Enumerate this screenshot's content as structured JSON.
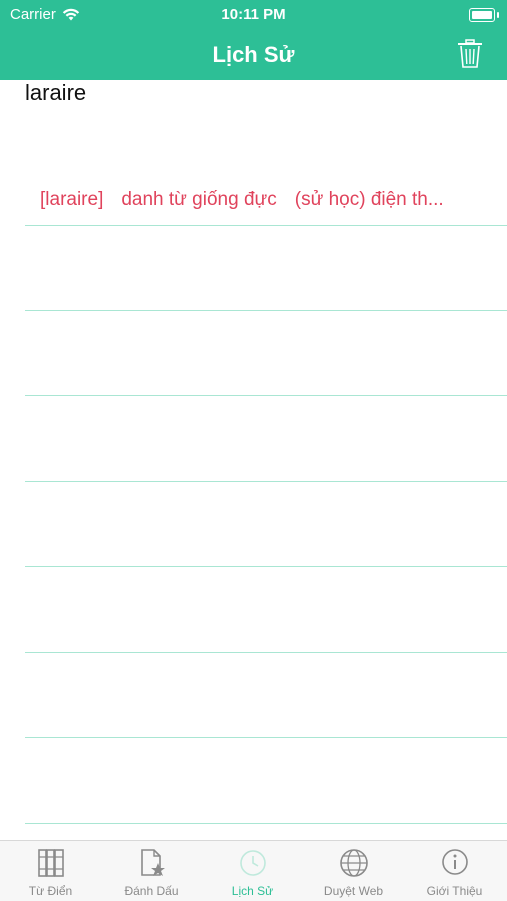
{
  "status": {
    "carrier": "Carrier",
    "time": "10:11 PM"
  },
  "nav": {
    "title": "Lịch Sử",
    "trash_icon": "trash-icon"
  },
  "history": [
    {
      "word": "laraire",
      "phonetic": "[laraire]",
      "pos": "danh từ giống đực",
      "definition": "(sử học) điện th..."
    }
  ],
  "tabs": [
    {
      "label": "Từ Điển",
      "icon": "books-icon"
    },
    {
      "label": "Đánh Dấu",
      "icon": "bookmark-document-icon"
    },
    {
      "label": "Lịch Sử",
      "icon": "clock-icon",
      "active": true
    },
    {
      "label": "Duyệt Web",
      "icon": "globe-icon"
    },
    {
      "label": "Giới Thiệu",
      "icon": "info-icon"
    }
  ],
  "colors": {
    "accent": "#2dbf96",
    "meaning": "#e0435c",
    "divider": "#a9e6d3"
  }
}
